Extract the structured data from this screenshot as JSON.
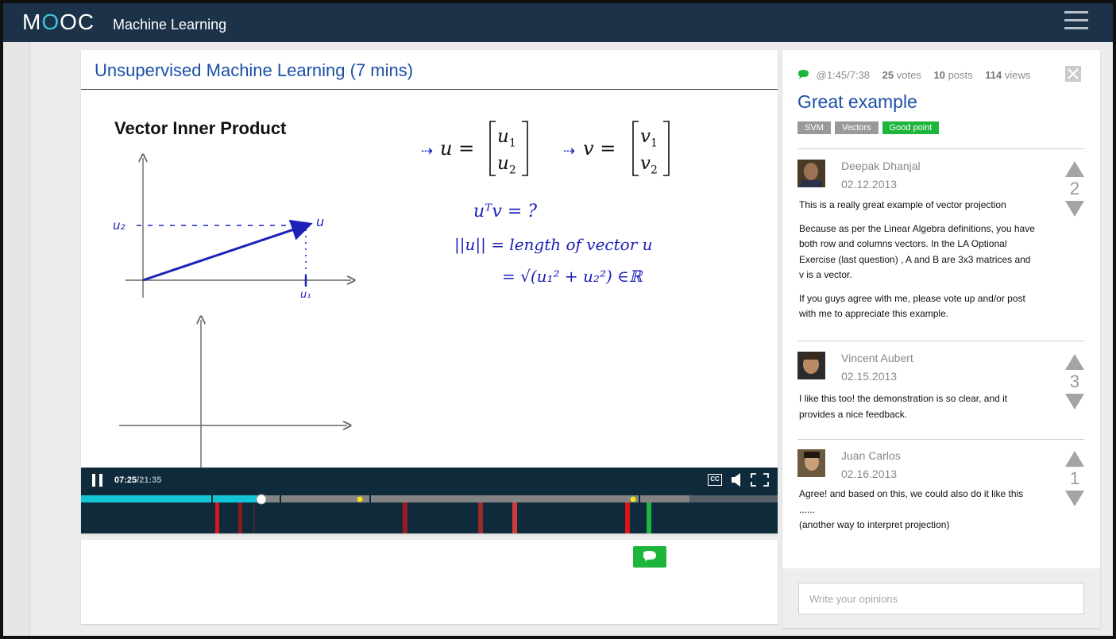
{
  "app": {
    "logo": [
      "M",
      "O",
      "O",
      "C"
    ],
    "course_title": "Machine Learning"
  },
  "video": {
    "title": "Unsupervised Machine Learning (7 mins)",
    "slide": {
      "heading": "Vector Inner Product",
      "u_def": "u =",
      "u1": "u",
      "u1_sub": "1",
      "u2": "u",
      "u2_sub": "2",
      "v_def": "v =",
      "v1": "v",
      "v1_sub": "1",
      "v2": "v",
      "v2_sub": "2"
    },
    "player": {
      "current_time": "07:25",
      "total_time": "/21:35",
      "cc_label": "CC",
      "progress_fraction": 0.259
    }
  },
  "thread": {
    "timestamp": "@1:45/7:38",
    "votes": "25",
    "votes_label": "votes",
    "posts": "10",
    "posts_label": "posts",
    "views": "114",
    "views_label": "views",
    "title": "Great example",
    "tags": [
      "SVM",
      "Vectors",
      "Good point"
    ],
    "posts_list": [
      {
        "author": "Deepak Dhanjal",
        "date": "02.12.2013",
        "votes": "2",
        "paragraphs": [
          "This is a really great example of vector projection",
          "Because as per the Linear Algebra definitions, you have both row and columns vectors. In the LA Optional Exercise (last question) , A and B are 3x3 matrices and v is a vector.",
          "If you guys agree with me, please vote up and/or post with me to appreciate this example."
        ]
      },
      {
        "author": "Vincent Aubert",
        "date": "02.15.2013",
        "votes": "3",
        "paragraphs": [
          "I like this too! the demonstration is so clear, and it provides a nice feedback."
        ]
      },
      {
        "author": "Juan Carlos",
        "date": "02.16.2013",
        "votes": "1",
        "paragraphs": [
          "Agree! and based on this, we could also do it like this ......",
          "(another way to interpret projection)"
        ]
      }
    ],
    "composer_placeholder": "Write your opinions"
  },
  "colors": {
    "topbar": "#1b3249",
    "accent_title": "#1b4fa6",
    "logo_accent": "#3cc3d7",
    "progress_played": "#12c6d6",
    "comment_green": "#1db53c",
    "marker_red": "#d9161b",
    "ink_blue": "#1d22b8"
  },
  "icons": {
    "menu": "hamburger-icon",
    "close": "close-icon",
    "comment": "speech-bubble-icon",
    "volume": "speaker-icon",
    "fullscreen": "fullscreen-icon",
    "pause": "pause-icon"
  }
}
